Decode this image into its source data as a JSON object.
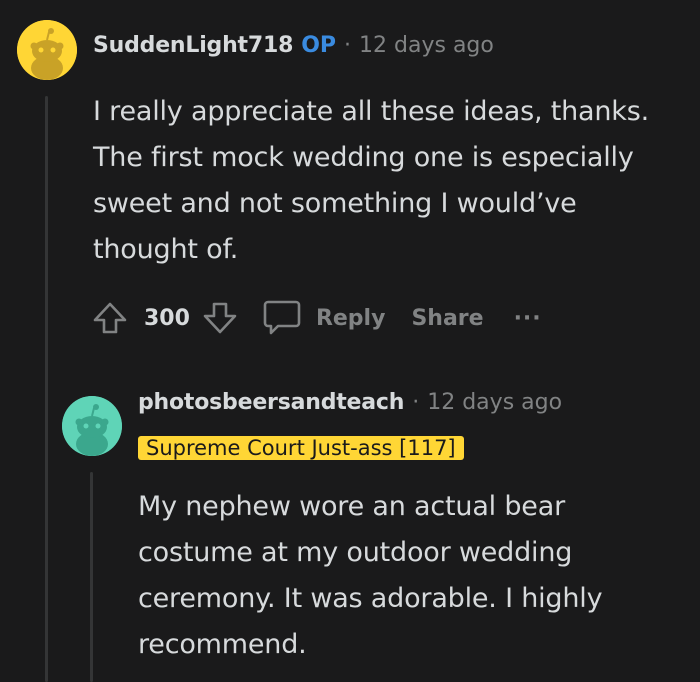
{
  "comment": {
    "username": "SuddenLight718",
    "op_badge": "OP",
    "separator": "·",
    "timestamp": "12 days ago",
    "body_lines": [
      "I really appreciate all these ideas, thanks.",
      "The first mock wedding one is especially",
      "sweet and not something I would’ve",
      "thought of."
    ],
    "vote_count": "300",
    "reply_label": "Reply",
    "share_label": "Share",
    "more_label": "···",
    "avatar_color": "#ffd635"
  },
  "reply": {
    "username": "photosbeersandteach",
    "separator": "·",
    "timestamp": "12 days ago",
    "flair": "Supreme Court Just-ass [117]",
    "flair_color": "#ffd635",
    "body_lines": [
      "My nephew wore an actual bear",
      "costume at my outdoor wedding",
      "ceremony. It was adorable. I highly",
      "recommend."
    ],
    "avatar_color": "#5fd4b7"
  }
}
